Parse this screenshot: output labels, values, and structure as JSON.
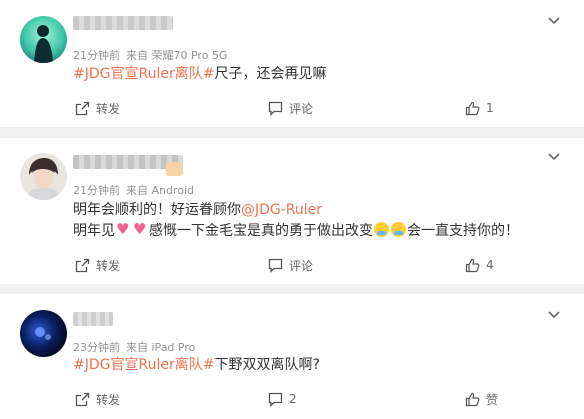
{
  "comments": [
    {
      "meta_time": "21分钟前",
      "meta_source": "来自 荣耀70 Pro 5G",
      "content_tag": "#JDG官宣Ruler离队#",
      "content_text": "尺子，还会再见嘛",
      "repost_label": "转发",
      "comment_label": "评论",
      "like_count": "1"
    },
    {
      "meta_time": "21分钟前",
      "meta_source": "来自 Android",
      "line1_text": "明年会顺利的！好运眷顾你",
      "line1_mention": "@JDG-Ruler",
      "line2_a": "明年见",
      "line2_b": "感慨一下金毛宝是真的勇于做出改变",
      "line2_c": "会一直支持你的！",
      "repost_label": "转发",
      "comment_label": "评论",
      "like_count": "4"
    },
    {
      "meta_time": "23分钟前",
      "meta_source": "来自 iPad Pro",
      "content_tag": "#JDG官宣Ruler离队#",
      "content_text": "下野双双离队啊?",
      "repost_label": "转发",
      "comment_count": "2",
      "like_label": "赞"
    }
  ],
  "colors": {
    "tag": "#eb7350",
    "meta": "#939393",
    "page_bg": "#f0f0f0"
  },
  "icons": [
    "repost-icon",
    "comment-icon",
    "thumbs-up-icon",
    "chevron-down-icon",
    "heart-emoji",
    "crying-emoji"
  ]
}
